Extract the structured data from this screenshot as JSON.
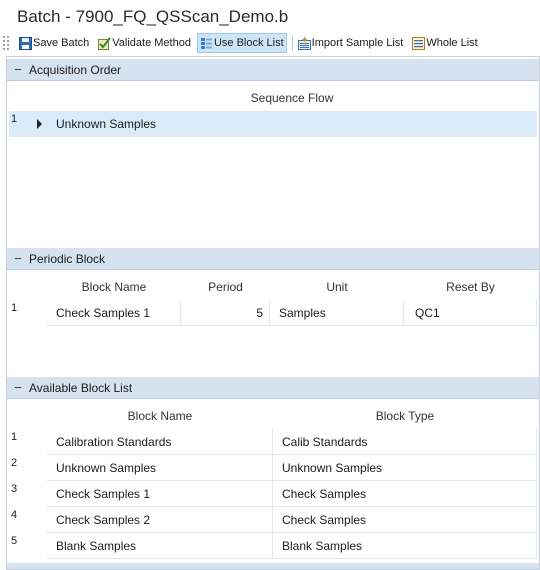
{
  "window": {
    "title": "Batch - 7900_FQ_QSScan_Demo.b"
  },
  "toolbar": {
    "items": [
      {
        "label": "Save Batch",
        "icon": "save-icon",
        "active": false
      },
      {
        "label": "Validate Method",
        "icon": "validate-icon",
        "active": false
      },
      {
        "label": "Use Block List",
        "icon": "block-list-icon",
        "active": true
      },
      {
        "label": "Import Sample List",
        "icon": "import-icon",
        "active": false
      },
      {
        "label": "Whole List",
        "icon": "whole-list-icon",
        "active": false
      }
    ]
  },
  "acquisition_order": {
    "header": "Acquisition Order",
    "collapse_glyph": "−",
    "column": "Sequence Flow",
    "rows": [
      {
        "num": "1",
        "value": "Unknown Samples",
        "selected": true
      }
    ]
  },
  "periodic_block": {
    "header": "Periodic Block",
    "collapse_glyph": "−",
    "columns": [
      "Block Name",
      "Period",
      "Unit",
      "Reset By"
    ],
    "rows": [
      {
        "num": "1",
        "block_name": "Check Samples 1",
        "period": "5",
        "unit": "Samples",
        "reset_by": "QC1"
      }
    ]
  },
  "available_block_list": {
    "header": "Available Block List",
    "collapse_glyph": "−",
    "columns": [
      "Block Name",
      "Block Type"
    ],
    "rows": [
      {
        "num": "1",
        "block_name": "Calibration Standards",
        "block_type": "Calib Standards"
      },
      {
        "num": "2",
        "block_name": "Unknown Samples",
        "block_type": "Unknown Samples"
      },
      {
        "num": "3",
        "block_name": "Check Samples 1",
        "block_type": "Check Samples"
      },
      {
        "num": "4",
        "block_name": "Check Samples 2",
        "block_type": "Check Samples"
      },
      {
        "num": "5",
        "block_name": "Blank Samples",
        "block_type": "Blank Samples"
      }
    ]
  },
  "colors": {
    "section_header_bg": "#d5e2f0",
    "selected_row_bg": "#d9ebf8",
    "active_button_bg": "#cde6f7"
  }
}
